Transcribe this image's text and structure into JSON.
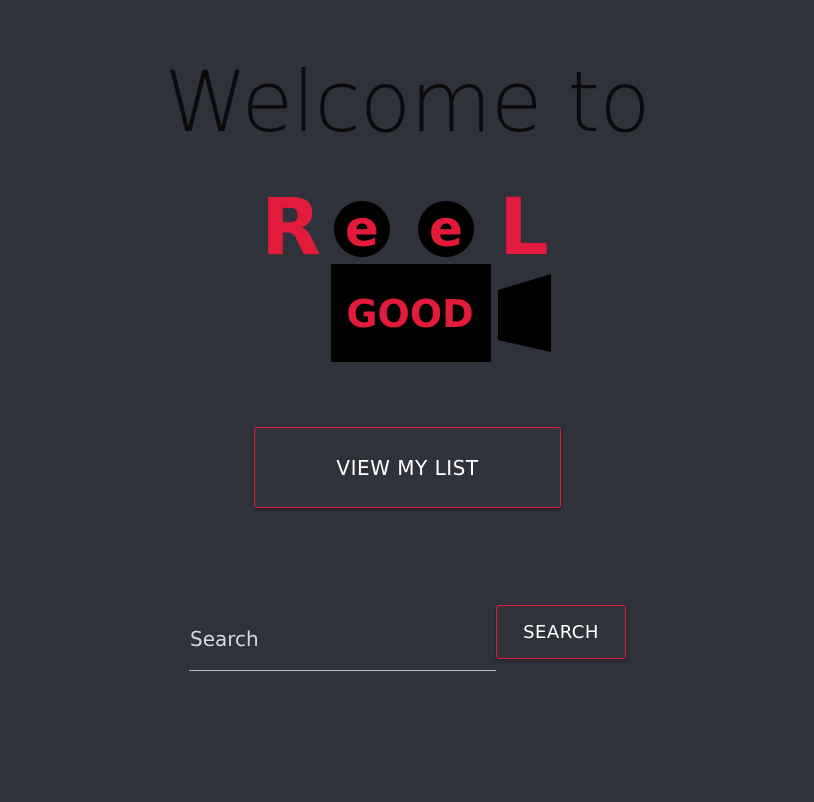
{
  "header": {
    "welcome_text": "Welcome to"
  },
  "logo": {
    "name_top": "ReeL",
    "name_bottom": "GOOD",
    "letters": [
      "R",
      "e",
      "e",
      "L"
    ],
    "icon": "movie-camera-icon",
    "brand_color": "#e21a3b",
    "dark_color": "#000000"
  },
  "actions": {
    "view_list_label": "VIEW MY LIST"
  },
  "search": {
    "placeholder": "Search",
    "value": "",
    "button_label": "SEARCH"
  },
  "theme": {
    "background": "#2f313b",
    "accent": "#e21a3b",
    "text": "#ffffff"
  }
}
